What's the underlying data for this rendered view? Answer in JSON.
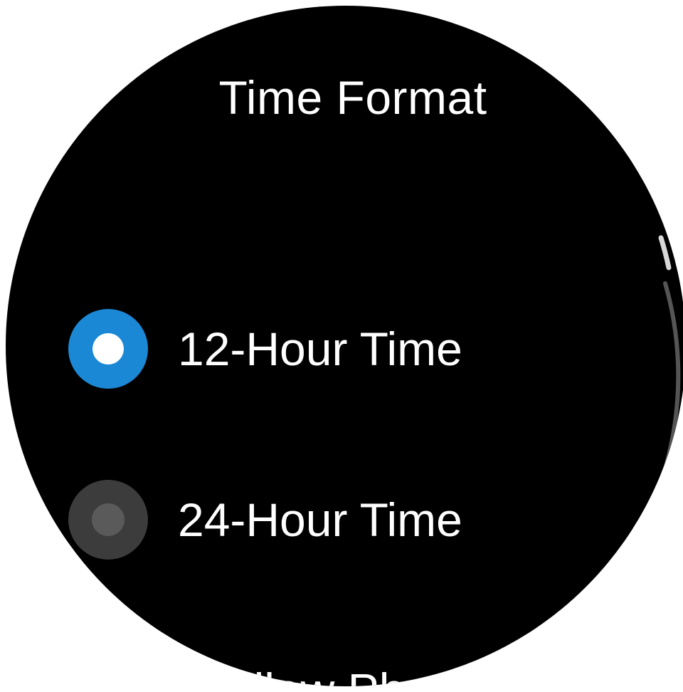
{
  "screen": {
    "title": "Time Format"
  },
  "options": [
    {
      "label": "12-Hour Time",
      "selected": true
    },
    {
      "label": "24-Hour Time",
      "selected": false
    }
  ],
  "next_item_partial": "Allow Phone",
  "colors": {
    "background": "#000000",
    "accent": "#1b88d6",
    "text": "#ffffff",
    "radio_off": "#3c3c3c"
  },
  "scroll": {
    "position_fraction": 0.15
  }
}
